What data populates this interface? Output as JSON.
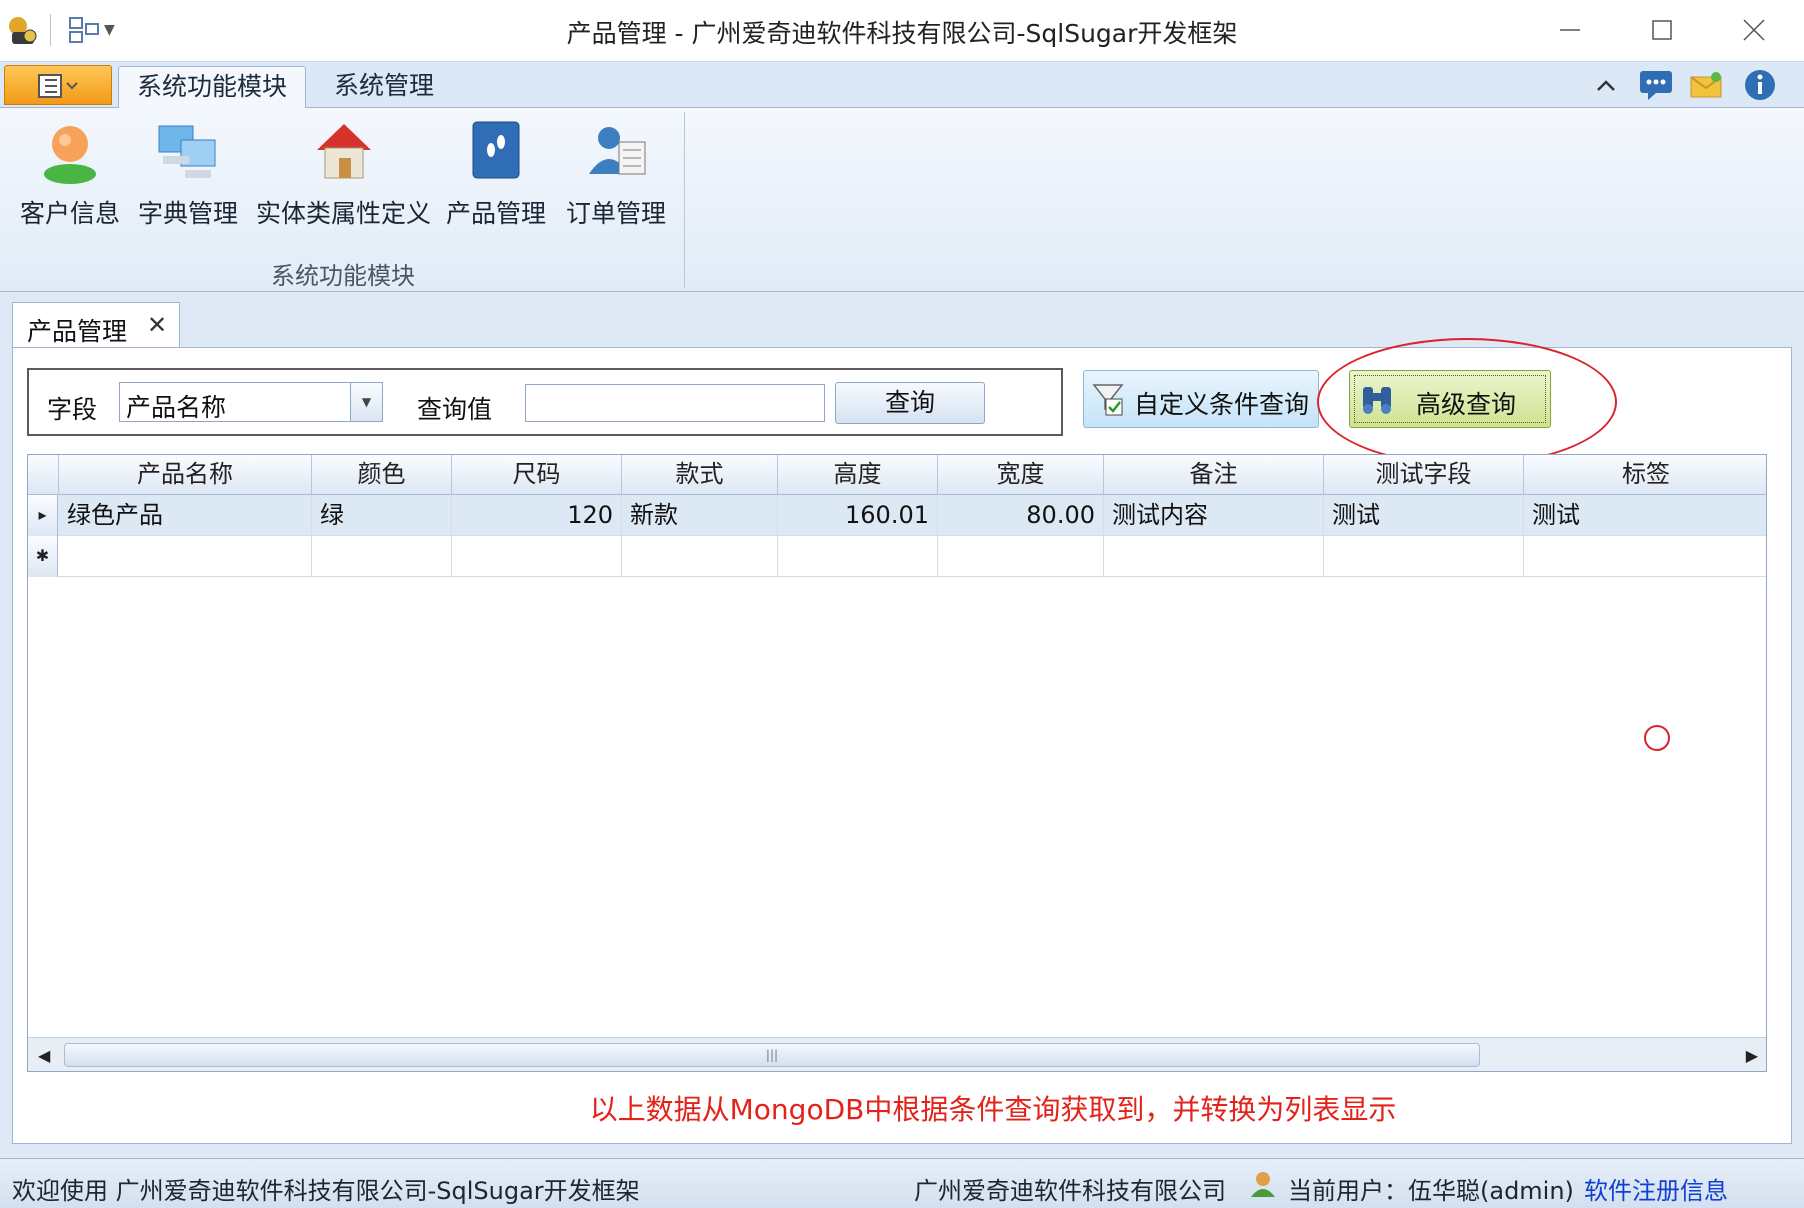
{
  "window": {
    "title": "产品管理 - 广州爱奇迪软件科技有限公司-SqlSugar开发框架"
  },
  "ribbon": {
    "tabs": [
      {
        "label": "系统功能模块",
        "active": true
      },
      {
        "label": "系统管理",
        "active": false
      }
    ],
    "buttons": [
      {
        "label": "客户信息",
        "icon": "customer-icon"
      },
      {
        "label": "字典管理",
        "icon": "dictionary-icon"
      },
      {
        "label": "实体类属性定义",
        "icon": "house-icon"
      },
      {
        "label": "产品管理",
        "icon": "product-icon"
      },
      {
        "label": "订单管理",
        "icon": "order-icon"
      }
    ],
    "group_label": "系统功能模块",
    "right_icons": [
      "collapse-ribbon-icon",
      "message-icon",
      "mail-icon",
      "info-icon"
    ]
  },
  "doc_tab": {
    "label": "产品管理",
    "close": "✕"
  },
  "query": {
    "field_label": "字段",
    "field_value": "产品名称",
    "value_label": "查询值",
    "value": "",
    "search_button": "查询",
    "custom_query_button": "自定义条件查询",
    "advanced_query_button": "高级查询"
  },
  "grid": {
    "columns": [
      "产品名称",
      "颜色",
      "尺码",
      "款式",
      "高度",
      "宽度",
      "备注",
      "测试字段",
      "标签"
    ],
    "rows": [
      [
        "绿色产品",
        "绿",
        "120",
        "新款",
        "160.01",
        "80.00",
        "测试内容",
        "测试",
        "测试"
      ]
    ],
    "new_row_marker": "✱",
    "current_row_marker": "▸"
  },
  "note": "以上数据从MongoDB中根据条件查询获取到，并转换为列表显示",
  "statusbar": {
    "welcome": "欢迎使用 广州爱奇迪软件科技有限公司-SqlSugar开发框架",
    "company": "广州爱奇迪软件科技有限公司",
    "current_user_label": "当前用户：",
    "current_user": "伍华聪(admin)",
    "register_link": "软件注册信息"
  },
  "colors": {
    "annotation_red": "#d9232e",
    "link_blue": "#1040d0",
    "app_menu_orange": "#f19a16"
  }
}
